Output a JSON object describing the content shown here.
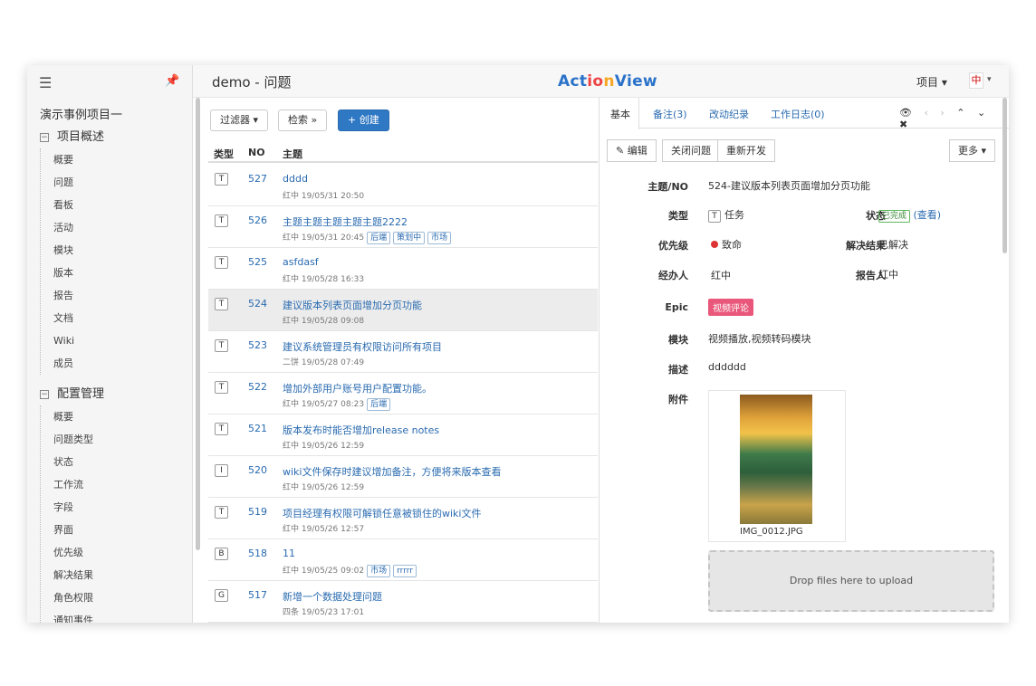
{
  "topbar": {
    "page_title": "demo - 问题",
    "logo_parts": [
      "Act",
      "io",
      "n",
      "View"
    ],
    "project_menu": "项目 ▾",
    "avatar": "中",
    "avatar_caret": "▾"
  },
  "sidebar": {
    "project": "演示事例项目一",
    "groups": [
      {
        "label": "项目概述",
        "items": [
          "概要",
          "问题",
          "看板",
          "活动",
          "模块",
          "版本",
          "报告",
          "文档",
          "Wiki",
          "成员"
        ]
      },
      {
        "label": "配置管理",
        "items": [
          "概要",
          "问题类型",
          "状态",
          "工作流",
          "字段",
          "界面",
          "优先级",
          "解决结果",
          "角色权限",
          "通知事件"
        ]
      }
    ]
  },
  "list": {
    "filter_btn": "过滤器 ▾",
    "search_btn": "检索 »",
    "create_btn": "+ 创建",
    "columns": {
      "type": "类型",
      "no": "NO",
      "subject": "主题"
    },
    "rows": [
      {
        "type": "T",
        "no": "527",
        "title": "dddd",
        "meta": "红中 19/05/31 20:50",
        "tags": []
      },
      {
        "type": "T",
        "no": "526",
        "title": "主题主题主题主题主题2222",
        "meta": "红中 19/05/31 20:45",
        "tags": [
          "后端",
          "策划中",
          "市场"
        ]
      },
      {
        "type": "T",
        "no": "525",
        "title": "asfdasf",
        "meta": "红中 19/05/28 16:33",
        "tags": []
      },
      {
        "type": "T",
        "no": "524",
        "title": "建议版本列表页面增加分页功能",
        "meta": "红中 19/05/28 09:08",
        "tags": []
      },
      {
        "type": "T",
        "no": "523",
        "title": "建议系统管理员有权限访问所有项目",
        "meta": "二饼 19/05/28 07:49",
        "tags": []
      },
      {
        "type": "T",
        "no": "522",
        "title": "增加外部用户账号用户配置功能。",
        "meta": "红中 19/05/27 08:23",
        "tags": [
          "后端"
        ]
      },
      {
        "type": "T",
        "no": "521",
        "title": "版本发布时能否增加release notes",
        "meta": "红中 19/05/26 12:59",
        "tags": []
      },
      {
        "type": "I",
        "no": "520",
        "title": "wiki文件保存时建议增加备注，方便将来版本查看",
        "meta": "红中 19/05/26 12:59",
        "tags": []
      },
      {
        "type": "T",
        "no": "519",
        "title": "项目经理有权限可解锁任意被锁住的wiki文件",
        "meta": "红中 19/05/26 12:57",
        "tags": []
      },
      {
        "type": "B",
        "no": "518",
        "title": "11",
        "meta": "红中 19/05/25 09:02",
        "tags": [
          "市场",
          "rrrrr"
        ]
      },
      {
        "type": "G",
        "no": "517",
        "title": "新增一个数据处理问题",
        "meta": "四条 19/05/23 17:01",
        "tags": []
      }
    ]
  },
  "detail": {
    "tabs": [
      "基本",
      "备注(3)",
      "改动纪录",
      "工作日志(0)"
    ],
    "nav_icons": {
      "eye": "👁",
      "prev": "‹",
      "next": "›",
      "up": "⌃",
      "down": "⌄",
      "close": "✖"
    },
    "buttons": {
      "edit": "✎ 编辑",
      "close_issue": "关闭问题",
      "reopen": "重新开发",
      "more": "更多 ▾"
    },
    "labels": {
      "subject_no": "主题/NO",
      "type": "类型",
      "status": "状态",
      "priority": "优先级",
      "resolution": "解决结果",
      "assignee": "经办人",
      "reporter": "报告人",
      "epic": "Epic",
      "module": "模块",
      "description": "描述",
      "attachment": "附件"
    },
    "values": {
      "subject_no": "524-建议版本列表页面增加分页功能",
      "type_badge": "T",
      "type": "任务",
      "status": "已完成",
      "status_link": "(查看)",
      "priority": "致命",
      "resolution": "已解决",
      "assignee": "红中",
      "reporter": "红中",
      "epic": "视频评论",
      "module": "视频播放,视频转码模块",
      "description": "dddddd",
      "attachment_name": "IMG_0012.JPG",
      "dropzone": "Drop files here to upload"
    }
  }
}
